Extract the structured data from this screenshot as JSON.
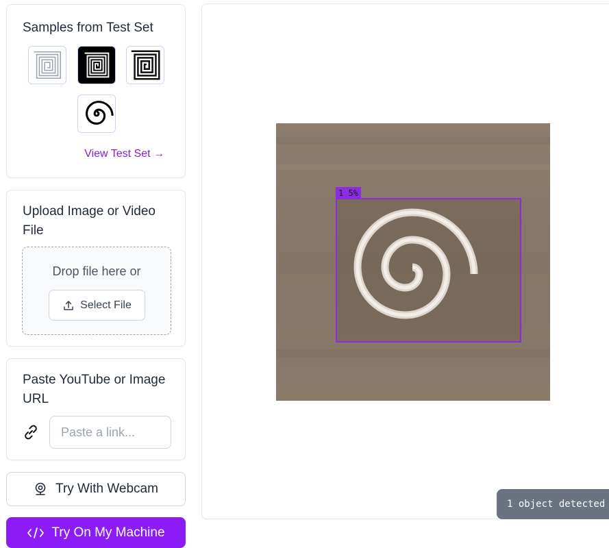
{
  "samples": {
    "title": "Samples from Test Set",
    "view_link": "View Test Set →",
    "items": [
      {
        "icon": "square-spiral-outline-icon"
      },
      {
        "icon": "square-spiral-black-icon"
      },
      {
        "icon": "square-spiral-bold-icon"
      },
      {
        "icon": "round-spiral-icon"
      }
    ]
  },
  "upload": {
    "title": "Upload Image or Video File",
    "drop_text": "Drop file here or",
    "select_label": "Select File",
    "select_icon": "upload-icon"
  },
  "url": {
    "title": "Paste YouTube or Image URL",
    "placeholder": "Paste a link...",
    "icon": "link-icon"
  },
  "webcam": {
    "label": "Try With Webcam",
    "icon": "webcam-icon"
  },
  "machine": {
    "label": "Try On My Machine",
    "icon": "code-icon",
    "color": "#8b1cf6"
  },
  "result": {
    "bbox_label": "1 5%",
    "bbox_color": "#8b2be2",
    "status": "1 object detected"
  }
}
